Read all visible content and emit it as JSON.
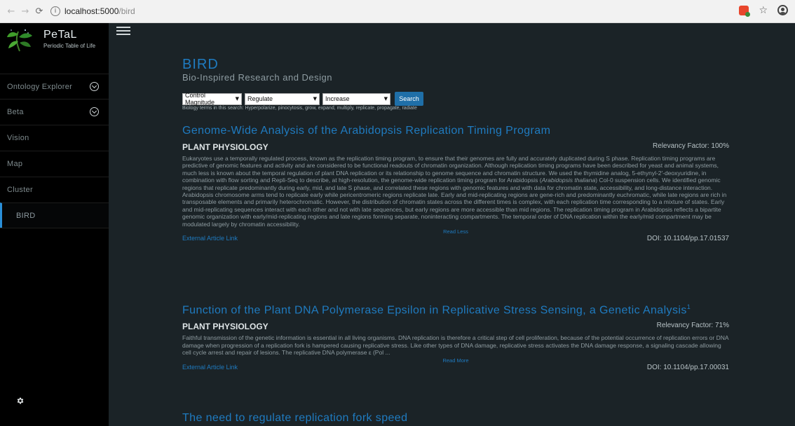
{
  "browser": {
    "url_host": "localhost:5000",
    "url_path": "/bird"
  },
  "sidebar": {
    "brand_title": "PeTaL",
    "brand_subtitle": "Periodic Table of Life",
    "items": [
      {
        "label": "Ontology Explorer",
        "expandable": true
      },
      {
        "label": "Beta",
        "expandable": true
      },
      {
        "label": "Vision",
        "expandable": false
      },
      {
        "label": "Map",
        "expandable": false
      },
      {
        "label": "Cluster",
        "expandable": false
      },
      {
        "label": "BIRD",
        "expandable": false,
        "active": true
      }
    ]
  },
  "page": {
    "title": "BIRD",
    "subtitle": "Bio-Inspired Research and Design"
  },
  "filters": {
    "magnitude": "Control Magnitude",
    "verb": "Regulate",
    "direction": "Increase",
    "search_label": "Search",
    "terms_text": "Biology terms in this search: Hyperpolarize, pinocytosis, grow, expand, multiply, replicate, propagate, radiate"
  },
  "articles": [
    {
      "title": "Genome-Wide Analysis of the Arabidopsis Replication Timing Program",
      "journal": "PLANT PHYSIOLOGY",
      "relevancy": "Relevancy Factor: 100%",
      "abstract_before": "Eukaryotes use a temporally regulated process, known as the replication timing program, to ensure that their genomes are fully and accurately duplicated during S phase. Replication timing programs are predictive of genomic features and activity and are considered to be functional readouts of chromatin organization. Although replication timing programs have been described for yeast and animal systems, much less is known about the temporal regulation of plant DNA replication or its relationship to genome sequence and chromatin structure. We used the thymidine analog, 5-ethynyl-2′-deoxyuridine, in combination with flow sorting and Repli-Seq to describe, at high-resolution, the genome-wide replication timing program for Arabidopsis (",
      "abstract_italic": "Arabidopsis thaliana",
      "abstract_after": ") Col-0 suspension cells. We identified genomic regions that replicate predominantly during early, mid, and late S phase, and correlated these regions with genomic features and with data for chromatin state, accessibility, and long-distance interaction. Arabidopsis chromosome arms tend to replicate early while pericentromeric regions replicate late. Early and mid-replicating regions are gene-rich and predominantly euchromatic, while late regions are rich in transposable elements and primarily heterochromatic. However, the distribution of chromatin states across the different times is complex, with each replication time corresponding to a mixture of states. Early and mid-replicating sequences interact with each other and not with late sequences, but early regions are more accessible than mid regions. The replication timing program in Arabidopsis reflects a bipartite genomic organization with early/mid-replicating regions and late regions forming separate, noninteracting compartments. The temporal order of DNA replication within the early/mid compartment may be modulated largely by chromatin accessibility.",
      "toggle": "Read Less",
      "link": "External Article Link",
      "doi": "DOI: 10.1104/pp.17.01537"
    },
    {
      "title": "Function of the Plant DNA Polymerase Epsilon in Replicative Stress Sensing, a Genetic Analysis",
      "title_sup": "1",
      "journal": "PLANT PHYSIOLOGY",
      "relevancy": "Relevancy Factor: 71%",
      "abstract_before": "Faithful transmission of the genetic information is essential in all living organisms. DNA replication is therefore a critical step of cell proliferation, because of the potential occurrence of replication errors or DNA damage when progression of a replication fork is hampered causing replicative stress. Like other types of DNA damage, replicative stress activates the DNA damage response, a signaling cascade allowing cell cycle arrest and repair of lesions. The replicative DNA polymerase ε (Pol ...",
      "toggle": "Read More",
      "link": "External Article Link",
      "doi": "DOI: 10.1104/pp.17.00031"
    },
    {
      "title": "The need to regulate replication fork speed"
    }
  ],
  "colors": {
    "accent": "#1f7bc0",
    "background": "#1b2327",
    "sidebar": "#000000"
  }
}
